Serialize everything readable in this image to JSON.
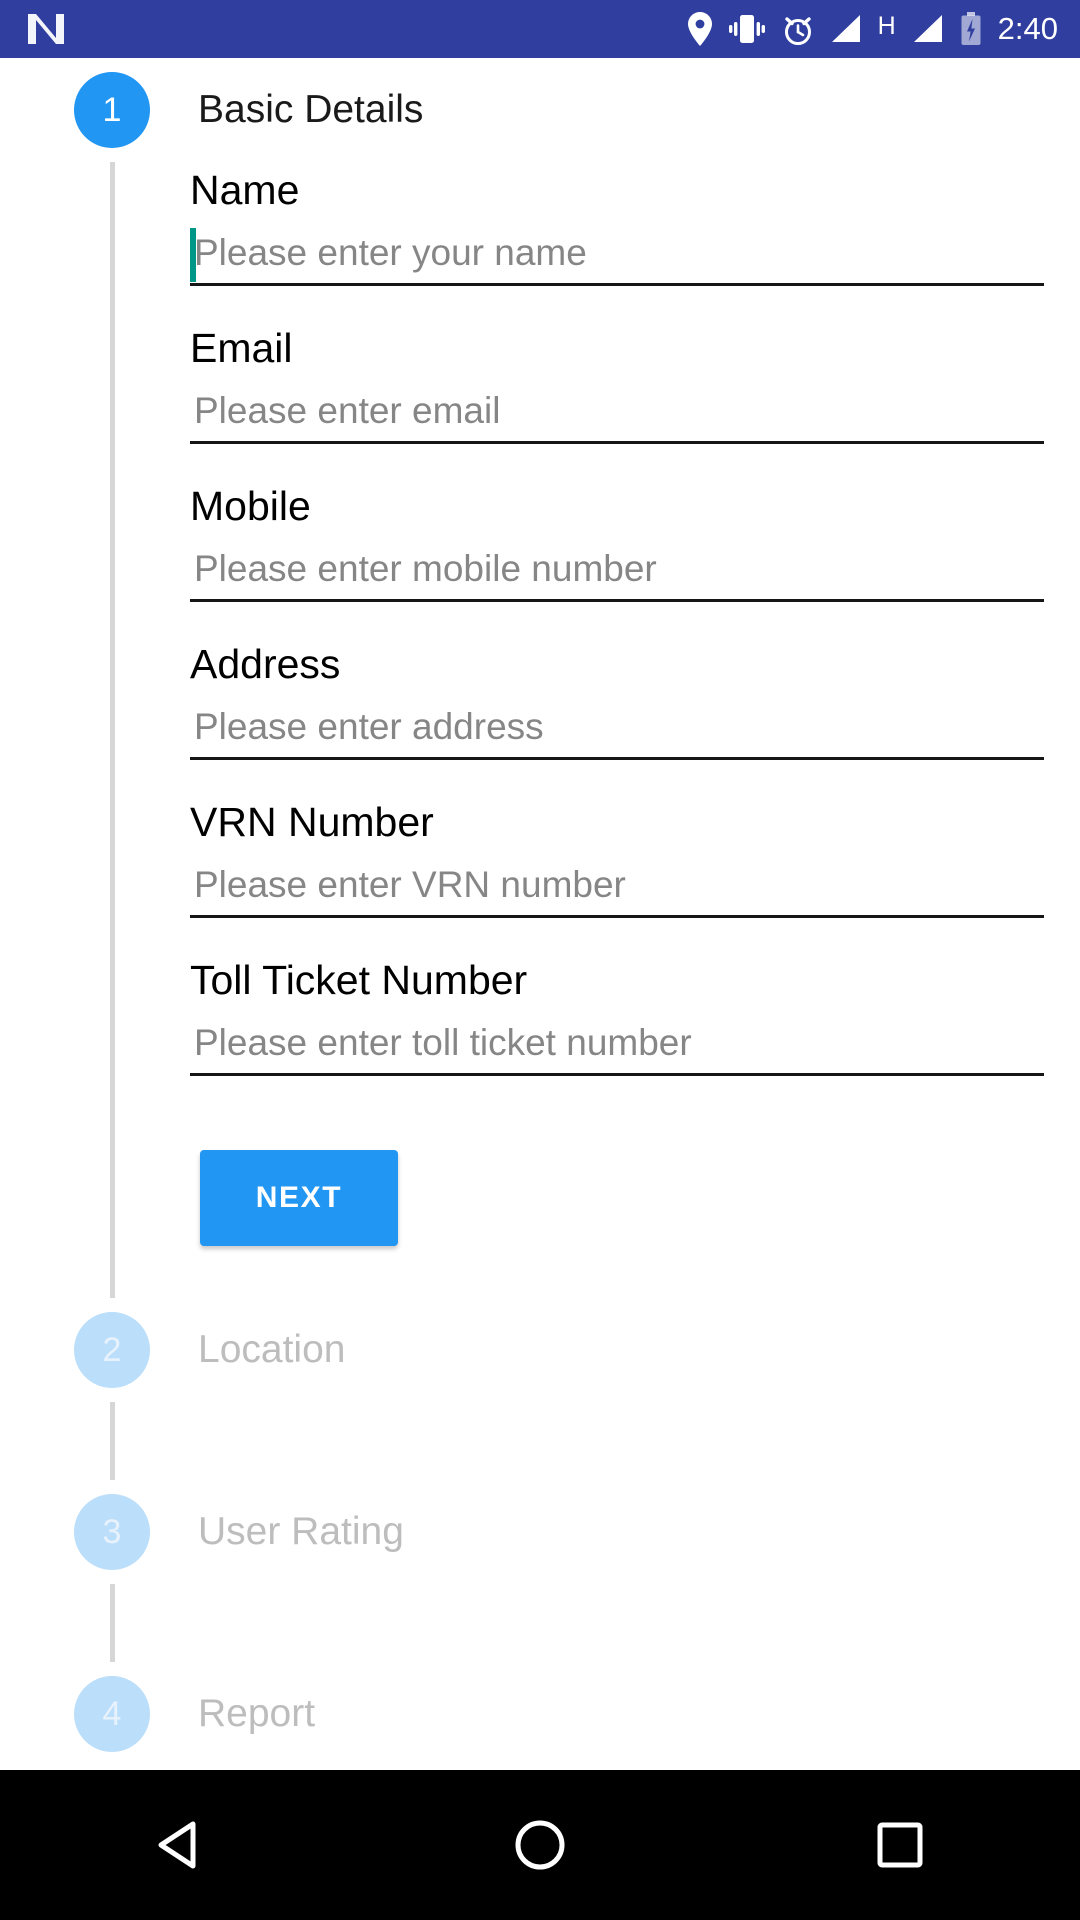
{
  "status_bar": {
    "background_color": "#303F9F",
    "logo_icon": "android-n-logo-icon",
    "icons": [
      "location-pin-icon",
      "vibrate-icon",
      "alarm-clock-icon",
      "signal-bars-icon",
      "hspa-network-icon",
      "signal-bars-icon",
      "battery-charging-icon"
    ],
    "network_label": "H",
    "clock": "2:40"
  },
  "theme": {
    "active_accent": "#2196F3",
    "inactive_circle": "#BBDEFB",
    "caret_color": "#009688",
    "underline_color": "#161616",
    "placeholder_color": "#868686",
    "inactive_text": "#bdbdbd",
    "connector_color": "#d6d6d6"
  },
  "stepper": {
    "steps": [
      {
        "number": "1",
        "title": "Basic Details",
        "state": "active",
        "fields": [
          {
            "label": "Name",
            "placeholder": "Please enter your name",
            "value": "",
            "focused": true
          },
          {
            "label": "Email",
            "placeholder": "Please enter email",
            "value": "",
            "focused": false
          },
          {
            "label": "Mobile",
            "placeholder": "Please enter mobile number",
            "value": "",
            "focused": false
          },
          {
            "label": "Address",
            "placeholder": "Please enter address",
            "value": "",
            "focused": false
          },
          {
            "label": "VRN Number",
            "placeholder": "Please enter VRN number",
            "value": "",
            "focused": false
          },
          {
            "label": "Toll Ticket Number",
            "placeholder": "Please enter toll ticket number",
            "value": "",
            "focused": false
          }
        ],
        "next_label": "NEXT"
      },
      {
        "number": "2",
        "title": "Location",
        "state": "inactive"
      },
      {
        "number": "3",
        "title": "User Rating",
        "state": "inactive"
      },
      {
        "number": "4",
        "title": "Report",
        "state": "inactive"
      }
    ]
  },
  "nav_bar": {
    "background_color": "#000000",
    "buttons": [
      {
        "icon": "back-triangle-icon",
        "label": "Back"
      },
      {
        "icon": "home-circle-icon",
        "label": "Home"
      },
      {
        "icon": "recents-square-icon",
        "label": "Recents"
      }
    ]
  }
}
